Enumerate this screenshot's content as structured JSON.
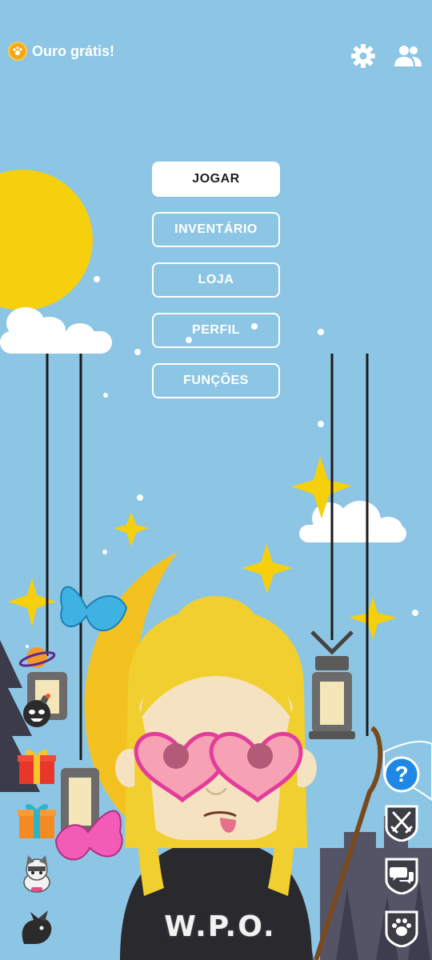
{
  "top_bar": {
    "free_gold_label": "Ouro grátis!",
    "settings_icon": "gear-icon",
    "friends_icon": "people-icon"
  },
  "menu": {
    "play": "JOGAR",
    "inventory": "INVENTÁRIO",
    "shop": "LOJA",
    "profile": "PERFIL",
    "roles": "FUNÇÕES"
  },
  "left_sidebar": [
    {
      "icon": "planet-icon"
    },
    {
      "icon": "bomb-icon"
    },
    {
      "icon": "red-gift-icon"
    },
    {
      "icon": "orange-gift-icon"
    },
    {
      "icon": "cat-pet-icon"
    },
    {
      "icon": "black-dragon-icon"
    }
  ],
  "right_sidebar": [
    {
      "icon": "help-icon",
      "label": "?"
    },
    {
      "icon": "swords-icon"
    },
    {
      "icon": "chat-bubbles-icon"
    },
    {
      "icon": "paw-icon"
    }
  ],
  "avatar": {
    "shirt_text": "W.P.O."
  },
  "colors": {
    "sky": "#8cc6e4",
    "sun": "#f6cf0d",
    "moon": "#f4c220",
    "hair": "#f1cf2e",
    "glasses": "#e23d9a",
    "help_button": "#1f88e5",
    "dark_button": "#3d3d45"
  }
}
